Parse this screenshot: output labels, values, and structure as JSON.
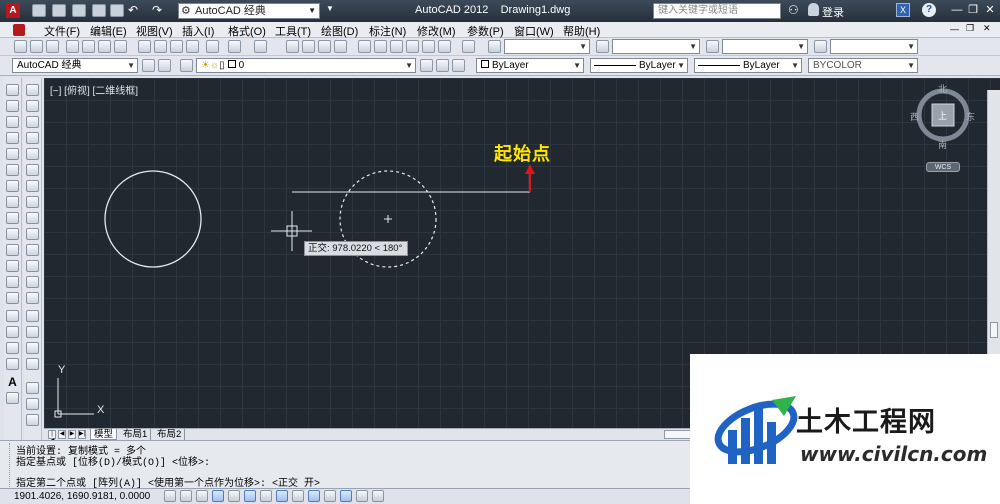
{
  "window": {
    "workspace": "AutoCAD 经典",
    "app_title": "AutoCAD 2012    Drawing1.dwg",
    "search_placeholder": "键入关键字或短语",
    "login": "登录"
  },
  "menu": [
    "文件(F)",
    "编辑(E)",
    "视图(V)",
    "插入(I)",
    "格式(O)",
    "工具(T)",
    "绘图(D)",
    "标注(N)",
    "修改(M)",
    "参数(P)",
    "窗口(W)",
    "帮助(H)"
  ],
  "toolbar2": {
    "workspace": "AutoCAD 经典",
    "layer": "0",
    "color": "ByLayer",
    "linetype": "ByLayer",
    "lineweight": "ByLayer",
    "plotstyle": "BYCOLOR"
  },
  "viewport": {
    "label": "[−] [俯视] [二维线框]",
    "hint": "起始点",
    "tooltip": "正交: 978.0220 < 180°",
    "viewcube": {
      "north": "北",
      "south": "南",
      "east": "东",
      "west": "西",
      "face": "上",
      "wcs": "WCS"
    },
    "ucs": {
      "x": "X",
      "y": "Y"
    }
  },
  "tabs": [
    "模型",
    "布局1",
    "布局2"
  ],
  "command": {
    "line1": "当前设置:  复制模式 = 多个",
    "line2": "指定基点或 [位移(D)/模式(O)] <位移>:",
    "line3": "指定第二个点或 [阵列(A)] <使用第一个点作为位移>: <正交 开>"
  },
  "status": {
    "coords": "1901.4026, 1690.9181, 0.0000"
  },
  "watermark": {
    "title": "土木工程网",
    "url": "www.civilcn.com"
  },
  "colors": {
    "canvas": "#212830",
    "hint": "#ffe600",
    "arrow": "#e0141a",
    "accent": "#1f63c4"
  }
}
